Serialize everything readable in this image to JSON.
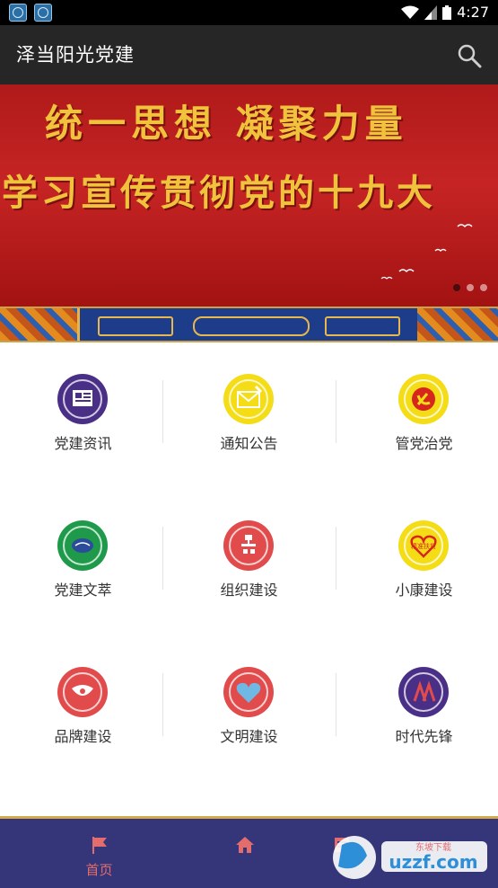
{
  "status_bar": {
    "time": "4:27",
    "app_icons": [
      "app-icon",
      "app-icon"
    ]
  },
  "toolbar": {
    "title": "泽当阳光党建",
    "search_icon": "search-icon"
  },
  "banner": {
    "line1": "统一思想  凝聚力量",
    "line2": "学习宣传贯彻党的十九大",
    "slide_count": 3,
    "active_slide": 1
  },
  "grid": {
    "items": [
      {
        "label": "党建资讯",
        "icon": "newspaper-icon",
        "color": "#4a2f86"
      },
      {
        "label": "通知公告",
        "icon": "envelope-icon",
        "color": "#f4dd17"
      },
      {
        "label": "管党治党",
        "icon": "hammer-sickle-icon",
        "color": "#f4dd17"
      },
      {
        "label": "党建文萃",
        "icon": "book-icon",
        "color": "#1e9a4a"
      },
      {
        "label": "组织建设",
        "icon": "organization-icon",
        "color": "#e24b4b"
      },
      {
        "label": "小康建设",
        "icon": "heart-badge-icon",
        "color": "#f4dd17",
        "badge_text": "精准扶贫"
      },
      {
        "label": "品牌建设",
        "icon": "flag-brand-icon",
        "color": "#e24b4b"
      },
      {
        "label": "文明建设",
        "icon": "heart-icon",
        "color": "#e24b4b"
      },
      {
        "label": "时代先锋",
        "icon": "pioneer-icon",
        "color": "#4a2f86"
      }
    ]
  },
  "footer": {
    "tabs": [
      {
        "label": "首页",
        "icon": "flag-icon",
        "active": true
      },
      {
        "label": "",
        "icon": "home-icon",
        "active": false
      },
      {
        "label": "",
        "icon": "book-tab-icon",
        "active": false
      }
    ]
  },
  "watermark": {
    "text": "uzzf.com",
    "subtext": "东坡下载"
  }
}
